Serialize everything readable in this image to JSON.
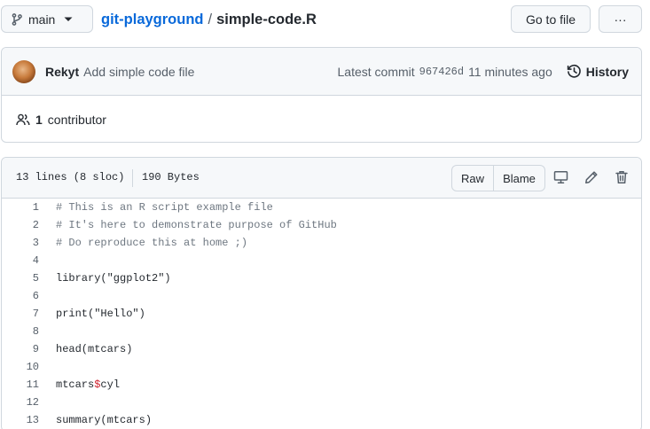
{
  "branch": {
    "label": "main"
  },
  "breadcrumb": {
    "repo": "git-playground",
    "separator": "/",
    "file": "simple-code.R"
  },
  "actions": {
    "go_to_file": "Go to file",
    "more": "···"
  },
  "commit": {
    "author": "Rekyt",
    "message": "Add simple code file",
    "latest_label": "Latest commit",
    "sha": "967426d",
    "time": "11 minutes ago",
    "history_label": "History"
  },
  "contributors": {
    "count": "1",
    "label": "contributor"
  },
  "file": {
    "lines_info": "13 lines (8 sloc)",
    "size": "190 Bytes",
    "raw_label": "Raw",
    "blame_label": "Blame"
  },
  "code_lines": [
    {
      "n": "1",
      "text": "# This is an R script example file",
      "comment": true
    },
    {
      "n": "2",
      "text": "# It's here to demonstrate purpose of GitHub",
      "comment": true
    },
    {
      "n": "3",
      "text": "# Do reproduce this at home ;)",
      "comment": true
    },
    {
      "n": "4",
      "text": "",
      "comment": false
    },
    {
      "n": "5",
      "text": "library(\"ggplot2\")",
      "comment": false
    },
    {
      "n": "6",
      "text": "",
      "comment": false
    },
    {
      "n": "7",
      "text": "print(\"Hello\")",
      "comment": false
    },
    {
      "n": "8",
      "text": "",
      "comment": false
    },
    {
      "n": "9",
      "text": "head(mtcars)",
      "comment": false
    },
    {
      "n": "10",
      "text": "",
      "comment": false
    },
    {
      "n": "11",
      "text": "mtcars",
      "suffix": "cyl",
      "dollar": "$",
      "comment": false
    },
    {
      "n": "12",
      "text": "",
      "comment": false
    },
    {
      "n": "13",
      "text": "summary(mtcars)",
      "comment": false
    }
  ],
  "colors": {
    "link": "#0969da",
    "border": "#d0d7de",
    "header_bg": "#f6f8fa",
    "muted": "#57606a",
    "dollar": "#cf222e"
  },
  "icons": [
    "branch-icon",
    "chevron-down-icon",
    "history-icon",
    "people-icon",
    "desktop-icon",
    "pencil-icon",
    "trash-icon"
  ]
}
